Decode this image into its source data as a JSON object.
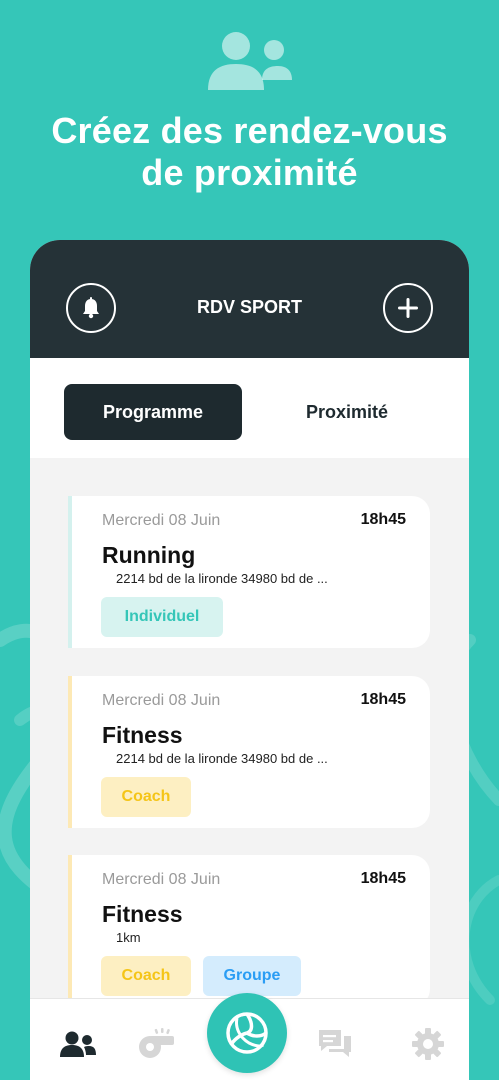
{
  "colors": {
    "background": "#35c6b8",
    "header": "#253237",
    "accent": "#2fc3b5",
    "individuel": "#35c6b8",
    "coach": "#f5c518",
    "groupe": "#2a9df4"
  },
  "hero": {
    "icon": "users-icon",
    "headline": "Créez des rendez-vous\nde proximité"
  },
  "app": {
    "title": "RDV SPORT",
    "left_icon": "bell-icon",
    "right_icon": "plus-icon"
  },
  "tabs": [
    {
      "label": "Programme",
      "active": true
    },
    {
      "label": "Proximité",
      "active": false
    }
  ],
  "events": [
    {
      "date": "Mercredi 08 Juin",
      "time": "18h45",
      "title": "Running",
      "address": "2214 bd de la lironde 34980 bd de ...",
      "tags": [
        "Individuel"
      ]
    },
    {
      "date": "Mercredi 08 Juin",
      "time": "18h45",
      "title": "Fitness",
      "address": "2214 bd de la lironde 34980 bd de ...",
      "tags": [
        "Coach"
      ]
    },
    {
      "date": "Mercredi 08 Juin",
      "time": "18h45",
      "title": "Fitness",
      "address": "1km",
      "tags": [
        "Coach",
        "Groupe"
      ]
    }
  ],
  "nav": [
    {
      "icon": "users-icon",
      "active": true
    },
    {
      "icon": "whistle-icon",
      "active": false
    },
    {
      "icon": "volleyball-icon",
      "active": false
    },
    {
      "icon": "chat-icon",
      "active": false
    },
    {
      "icon": "settings-icon",
      "active": false
    }
  ]
}
